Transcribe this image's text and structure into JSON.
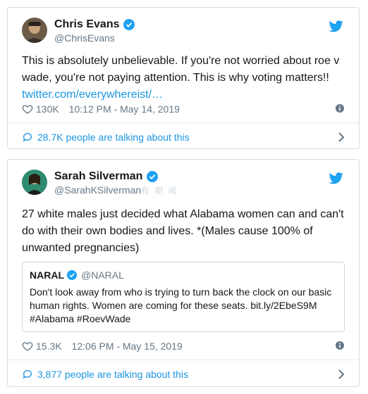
{
  "colors": {
    "accent": "#1da1f2",
    "link": "#1b95e0",
    "muted": "#657786",
    "text": "#14171a"
  },
  "tweets": [
    {
      "display_name": "Chris Evans",
      "handle": "@ChrisEvans",
      "text": "This is absolutely unbelievable. If you're not worried about roe v wade, you're not paying attention. This is why voting matters!!",
      "link": "twitter.com/everywhereist/…",
      "likes": "130K",
      "timestamp": "10:12 PM - May 14, 2019",
      "talking": "28.7K people are talking about this"
    },
    {
      "display_name": "Sarah Silverman",
      "handle": "@SarahKSilverman",
      "text": "27 white males just decided what Alabama women can and can't do with their own bodies and lives.  *(Males cause 100% of unwanted pregnancies)",
      "likes": "15.3K",
      "timestamp": "12:06 PM - May 15, 2019",
      "talking": "3,877 people are talking about this",
      "quote": {
        "name": "NARAL",
        "handle": "@NARAL",
        "text": "Don't look away from who is trying to turn back the clock on our basic human rights. Women are coming for these seats. bit.ly/2EbeS9M #Alabama #RoevWade"
      }
    }
  ],
  "watermark": "有 期 阅"
}
